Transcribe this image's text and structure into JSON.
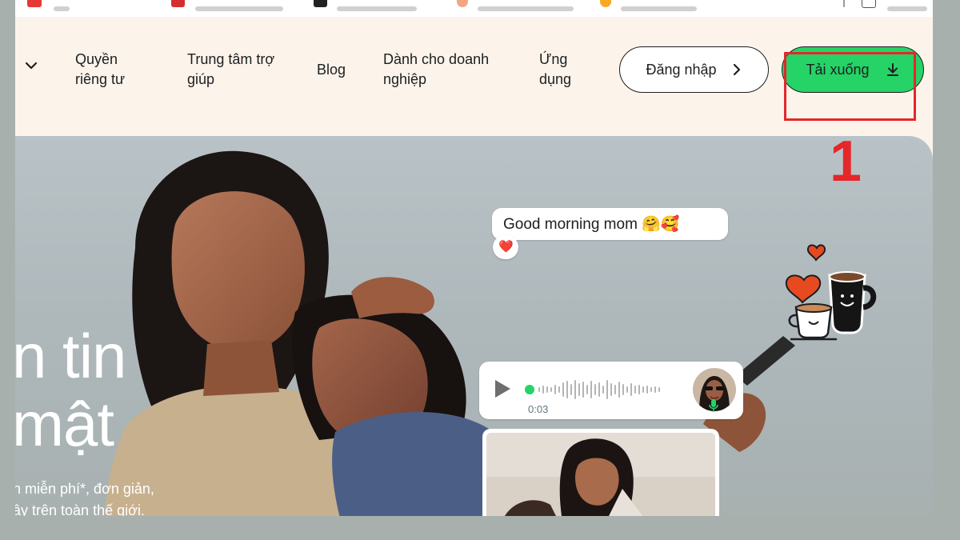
{
  "nav": {
    "items": [
      {
        "line1": "Quyền",
        "line2": "riêng tư"
      },
      {
        "line1": "Trung tâm trợ",
        "line2": "giúp"
      },
      {
        "line1": "Blog",
        "line2": ""
      },
      {
        "line1": "Dành cho doanh",
        "line2": "nghiệp"
      },
      {
        "line1": "Ứng",
        "line2": "dụng"
      }
    ],
    "login_label": "Đăng nhập",
    "download_label": "Tải xuống",
    "step_number": "1"
  },
  "hero": {
    "title_line1": "n tin",
    "title_line2": "mật",
    "sub_line1": "n miễn phí*, đơn giản,",
    "sub_line2": "ây trên toàn thế giới.",
    "message_text": "Good morning mom 🤗🥰",
    "reaction": "❤️",
    "voice_duration": "0:03"
  },
  "colors": {
    "accent_green": "#25d366",
    "highlight_red": "#e5262a",
    "page_bg": "#fcf4ea"
  }
}
